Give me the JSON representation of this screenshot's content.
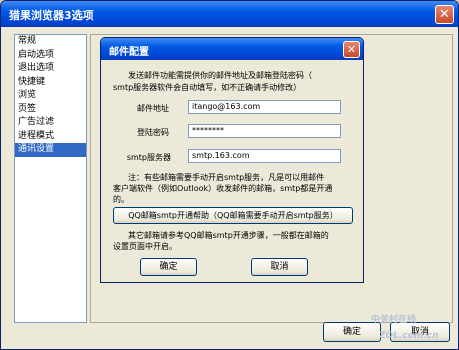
{
  "main_window": {
    "title": "猎果浏览器3选项",
    "close_glyph": "✕"
  },
  "sidebar": {
    "items": [
      {
        "label": "常规",
        "selected": false
      },
      {
        "label": "启动选项",
        "selected": false
      },
      {
        "label": "退出选项",
        "selected": false
      },
      {
        "label": "快捷键",
        "selected": false
      },
      {
        "label": "浏览",
        "selected": false
      },
      {
        "label": "页签",
        "selected": false
      },
      {
        "label": "广告过滤",
        "selected": false
      },
      {
        "label": "进程模式",
        "selected": false
      },
      {
        "label": "通讯设置",
        "selected": true
      }
    ]
  },
  "footer": {
    "ok_label": "确定",
    "cancel_label": "取消"
  },
  "dialog": {
    "title": "邮件配置",
    "close_glyph": "✕",
    "intro_line1": "发送邮件功能需提供你的邮件地址及邮箱登陆密码（",
    "intro_line2": "smtp服务器软件会自动填写，如不正确请手动修改）",
    "email_label": "邮件地址",
    "email_value": "itango@163.com",
    "password_label": "登陆密码",
    "password_value": "********",
    "smtp_label": "smtp服务器",
    "smtp_value": "smtp.163.com",
    "note_line1": "注：有些邮箱需要手动开启smtp服务，凡是可以用邮件",
    "note_line2": "客户端软件（例如Outlook）收发邮件的邮箱，smtp都是开通",
    "note_line3": "的。",
    "qq_help_button": "QQ邮箱smtp开通帮助（QQ邮箱需要手动开启smtp服务）",
    "other_line1": "其它邮箱请参考QQ邮箱smtp开通步骤，一般都在邮箱的",
    "other_line2": "设置页面中开启。",
    "ok_label": "确定",
    "cancel_label": "取消"
  },
  "watermark": {
    "line1": "中关村在线",
    "line2": "ZOL.com.cn"
  }
}
